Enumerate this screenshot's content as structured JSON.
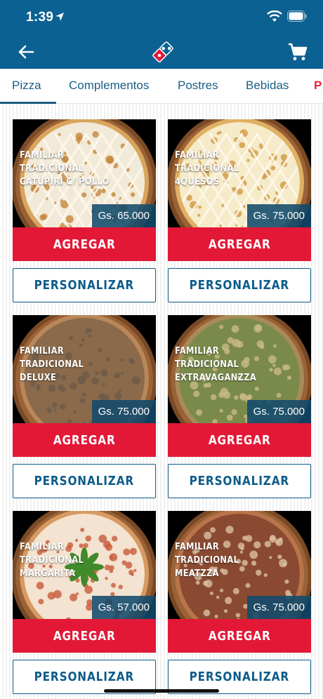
{
  "status_bar": {
    "time": "1:39"
  },
  "tabs": [
    {
      "label": "Pizza",
      "active": true
    },
    {
      "label": "Complementos"
    },
    {
      "label": "Postres"
    },
    {
      "label": "Bebidas"
    },
    {
      "label": "P"
    }
  ],
  "products": [
    {
      "name_line1": "FAMILIAR TRADICIONAL",
      "name_line2": "CATUPIRI C/ POLLO",
      "price": "Gs. 65.000",
      "add_label": "AGREGAR",
      "customize_label": "PERSONALIZAR",
      "topping": "catupiri"
    },
    {
      "name_line1": "FAMILIAR TRADICIONAL",
      "name_line2": "4QUESOS",
      "price": "Gs. 75.000",
      "add_label": "AGREGAR",
      "customize_label": "PERSONALIZAR",
      "topping": "quesos"
    },
    {
      "name_line1": "FAMILIAR TRADICIONAL",
      "name_line2": "DELUXE",
      "price": "Gs. 75.000",
      "add_label": "AGREGAR",
      "customize_label": "PERSONALIZAR",
      "topping": "deluxe"
    },
    {
      "name_line1": "FAMILIAR TRADICIONAL",
      "name_line2": "EXTRAVAGANZZA",
      "price": "Gs. 75.000",
      "add_label": "AGREGAR",
      "customize_label": "PERSONALIZAR",
      "topping": "extravaganzza"
    },
    {
      "name_line1": "FAMILIAR TRADICIONAL",
      "name_line2": "MARGARITA",
      "price": "Gs. 57.000",
      "add_label": "AGREGAR",
      "customize_label": "PERSONALIZAR",
      "topping": "margarita"
    },
    {
      "name_line1": "FAMILIAR TRADICIONAL",
      "name_line2": "MEATZZA",
      "price": "Gs. 75.000",
      "add_label": "AGREGAR",
      "customize_label": "PERSONALIZAR",
      "topping": "meatzza"
    }
  ],
  "colors": {
    "brand_blue": "#0c6193",
    "brand_red": "#e31837",
    "price_bg": "#114a6c"
  },
  "icons": {
    "back": "arrow-left-icon",
    "logo": "dominos-logo",
    "cart": "shopping-cart-icon",
    "location": "location-arrow-icon",
    "wifi": "wifi-icon",
    "battery": "battery-icon"
  }
}
